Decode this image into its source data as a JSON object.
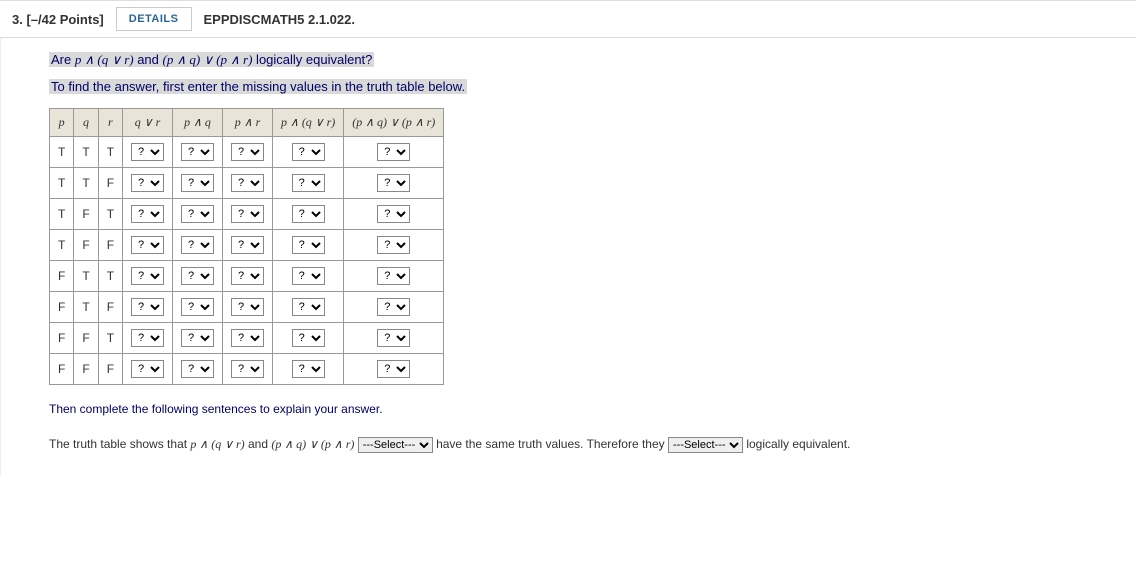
{
  "header": {
    "qnum": "3.  [–/42 Points]",
    "details": "DETAILS",
    "ref": "EPPDISCMATH5 2.1.022."
  },
  "question": {
    "line1_pre": "Are ",
    "expr1": "p ∧ (q ∨ r)",
    "line1_mid": " and ",
    "expr2": "(p ∧ q) ∨ (p ∧ r)",
    "line1_post": " logically equivalent?",
    "line2": "To find the answer, first enter the missing values in the truth table below."
  },
  "table": {
    "headers": [
      "p",
      "q",
      "r",
      "q ∨ r",
      "p ∧ q",
      "p ∧ r",
      "p ∧ (q ∨ r)",
      "(p ∧ q) ∨ (p ∧ r)"
    ],
    "rows": [
      [
        "T",
        "T",
        "T"
      ],
      [
        "T",
        "T",
        "F"
      ],
      [
        "T",
        "F",
        "T"
      ],
      [
        "T",
        "F",
        "F"
      ],
      [
        "F",
        "T",
        "T"
      ],
      [
        "F",
        "T",
        "F"
      ],
      [
        "F",
        "F",
        "T"
      ],
      [
        "F",
        "F",
        "F"
      ]
    ],
    "select_placeholder": "?"
  },
  "explain": {
    "line1": "Then complete the following sentences to explain your answer.",
    "final_pre": "The truth table shows that ",
    "final_expr1": "p ∧ (q ∨ r)",
    "final_mid1": " and ",
    "final_expr2": "(p ∧ q) ∨ (p ∧ r)",
    "select1_placeholder": "---Select---",
    "final_mid2": " have the same truth values. Therefore they ",
    "select2_placeholder": "---Select---",
    "final_post": " logically equivalent."
  }
}
